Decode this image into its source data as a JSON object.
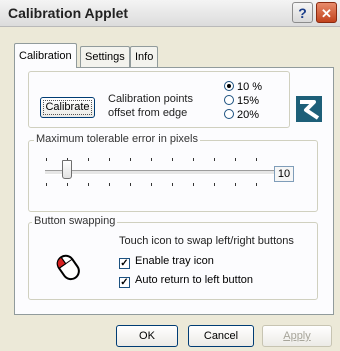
{
  "window": {
    "title": "Calibration Applet",
    "help_glyph": "?",
    "close_glyph": "✕"
  },
  "tabs": [
    {
      "label": "Calibration",
      "active": true
    },
    {
      "label": "Settings"
    },
    {
      "label": "Info"
    }
  ],
  "calibration": {
    "button_label": "Calibrate",
    "points_label_line1": "Calibration points",
    "points_label_line2": "offset from edge",
    "options": [
      {
        "label": "10 %",
        "selected": true
      },
      {
        "label": "15%"
      },
      {
        "label": "20%"
      }
    ],
    "logo_icon": "blue-s-logo-icon"
  },
  "error_group": {
    "title": "Maximum tolerable error in pixels",
    "value": "10"
  },
  "swap_group": {
    "title": "Button swapping",
    "description": "Touch icon to swap left/right buttons",
    "enable_tray_label": "Enable tray icon",
    "enable_tray_checked": true,
    "auto_return_label": "Auto return to left button",
    "auto_return_checked": true,
    "mouse_icon": "mouse-icon"
  },
  "footer": {
    "ok_label": "OK",
    "cancel_label": "Cancel",
    "apply_label": "Apply"
  }
}
